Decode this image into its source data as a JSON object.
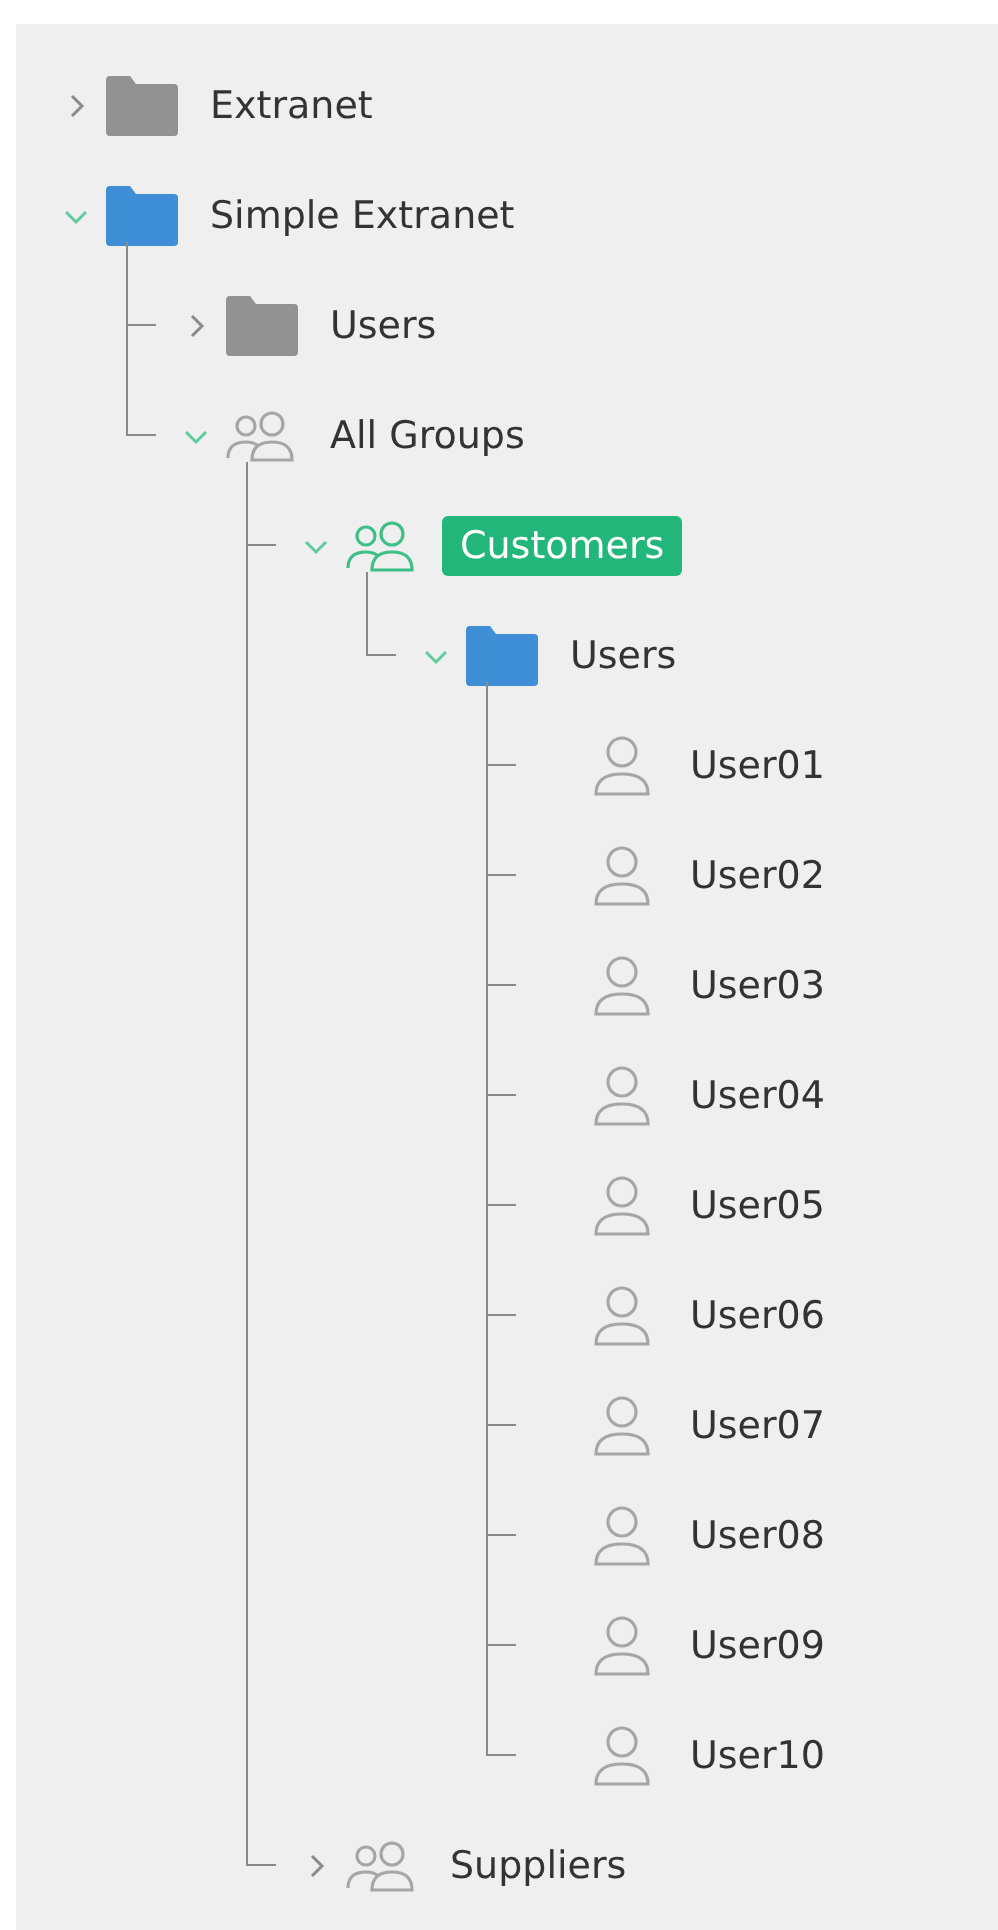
{
  "tree": [
    {
      "label": "Extranet",
      "kind": "folder",
      "expanded": false,
      "selected": false
    },
    {
      "label": "Simple Extranet",
      "kind": "folder",
      "expanded": true,
      "selected": false,
      "children": [
        {
          "label": "Users",
          "kind": "folder",
          "expanded": false,
          "selected": false
        },
        {
          "label": "All Groups",
          "kind": "group",
          "expanded": true,
          "selected": false,
          "children": [
            {
              "label": "Customers",
              "kind": "group",
              "expanded": true,
              "selected": true,
              "children": [
                {
                  "label": "Users",
                  "kind": "folder",
                  "expanded": true,
                  "selected": false,
                  "children": [
                    {
                      "label": "User01",
                      "kind": "user",
                      "selected": false
                    },
                    {
                      "label": "User02",
                      "kind": "user",
                      "selected": false
                    },
                    {
                      "label": "User03",
                      "kind": "user",
                      "selected": false
                    },
                    {
                      "label": "User04",
                      "kind": "user",
                      "selected": false
                    },
                    {
                      "label": "User05",
                      "kind": "user",
                      "selected": false
                    },
                    {
                      "label": "User06",
                      "kind": "user",
                      "selected": false
                    },
                    {
                      "label": "User07",
                      "kind": "user",
                      "selected": false
                    },
                    {
                      "label": "User08",
                      "kind": "user",
                      "selected": false
                    },
                    {
                      "label": "User09",
                      "kind": "user",
                      "selected": false
                    },
                    {
                      "label": "User10",
                      "kind": "user",
                      "selected": false
                    }
                  ]
                }
              ]
            },
            {
              "label": "Suppliers",
              "kind": "group",
              "expanded": false,
              "selected": false
            }
          ]
        }
      ]
    }
  ]
}
